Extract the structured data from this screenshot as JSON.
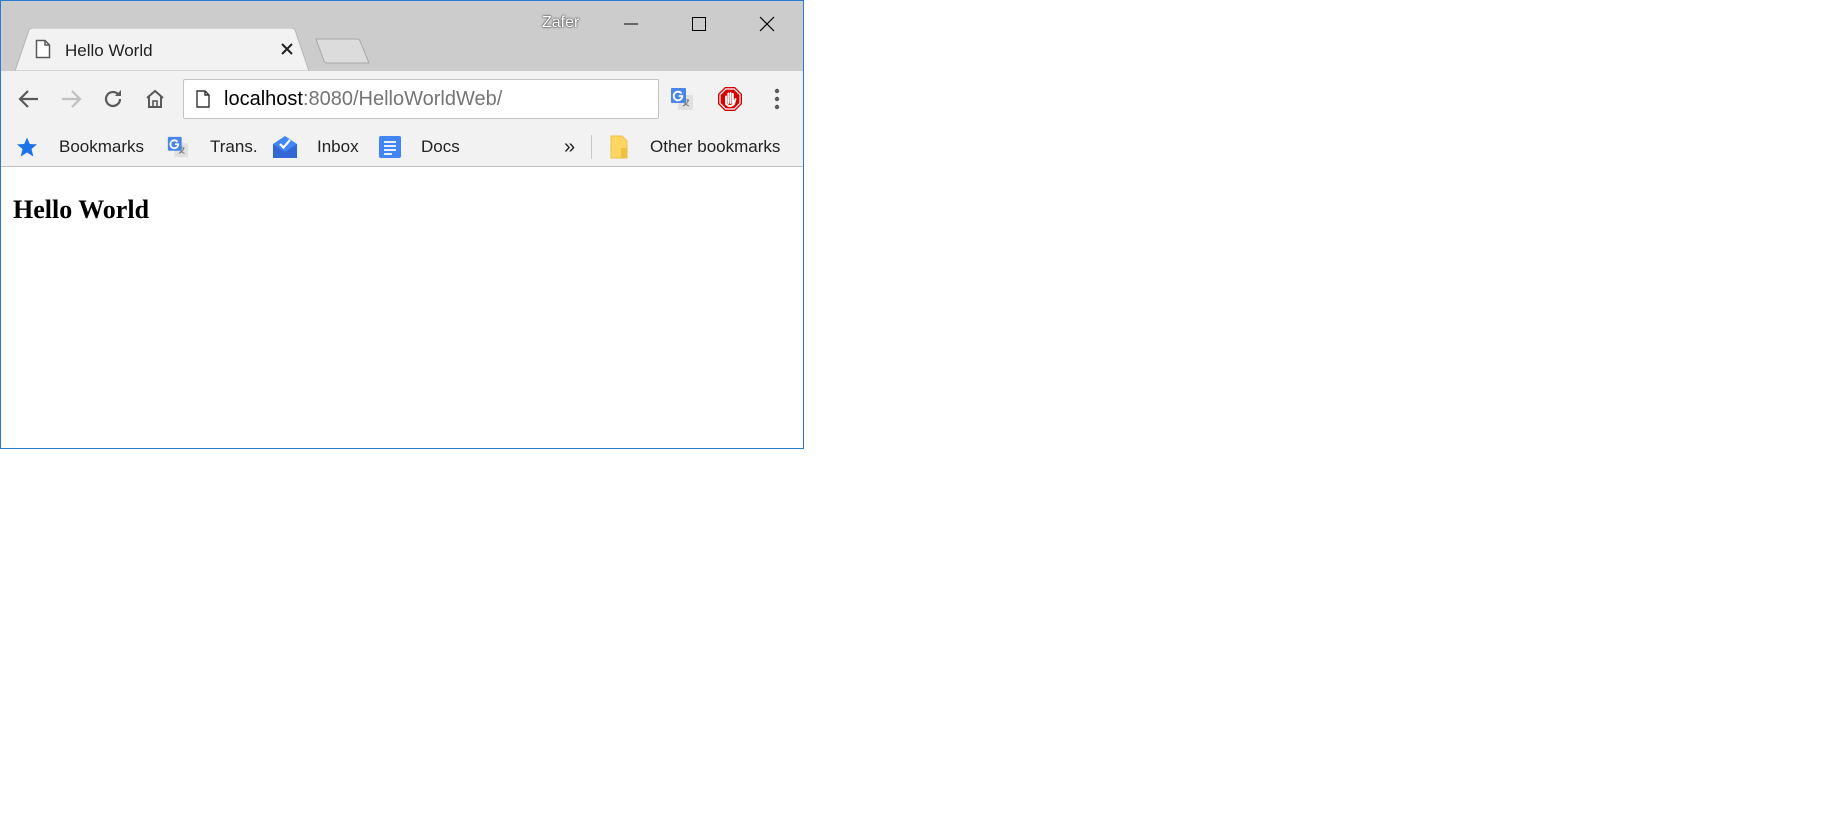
{
  "window": {
    "profile_name": "Zafer",
    "accent_border": "#2b7bd4"
  },
  "tabs": [
    {
      "title": "Hello World",
      "icon": "page-icon",
      "active": true
    }
  ],
  "toolbar": {
    "back_icon": "arrow-left-icon",
    "forward_icon": "arrow-right-icon",
    "reload_icon": "reload-icon",
    "home_icon": "home-icon",
    "menu_icon": "three-dots-icon"
  },
  "address_bar": {
    "host": "localhost",
    "rest": ":8080/HelloWorldWeb/"
  },
  "extensions": [
    {
      "name": "google-translate-icon"
    },
    {
      "name": "adblock-stop-icon"
    }
  ],
  "bookmarks_bar": {
    "items": [
      {
        "label": "Bookmarks",
        "icon": "star-icon"
      },
      {
        "label": "Trans.",
        "icon": "google-translate-icon"
      },
      {
        "label": "Inbox",
        "icon": "inbox-icon"
      },
      {
        "label": "Docs",
        "icon": "docs-icon"
      }
    ],
    "overflow": "»",
    "other": {
      "label": "Other bookmarks",
      "icon": "folder-icon"
    }
  },
  "page": {
    "heading": "Hello World"
  }
}
